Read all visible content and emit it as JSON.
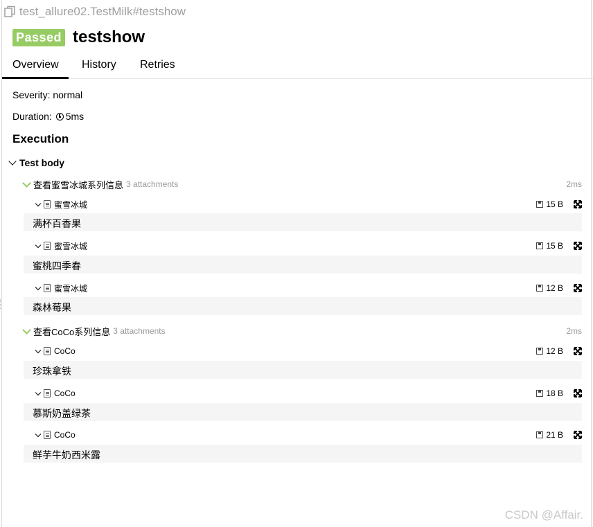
{
  "breadcrumb": "test_allure02.TestMilk#testshow",
  "status_badge": "Passed",
  "title": "testshow",
  "tabs": [
    {
      "label": "Overview",
      "active": true
    },
    {
      "label": "History",
      "active": false
    },
    {
      "label": "Retries",
      "active": false
    }
  ],
  "severity": "Severity: normal",
  "duration_label": "Duration:",
  "duration_value": "5ms",
  "execution_heading": "Execution",
  "test_body_label": "Test body",
  "steps": [
    {
      "name": "查看蜜雪冰城系列信息",
      "attachments_label": "3 attachments",
      "duration": "2ms",
      "attachments": [
        {
          "name": "蜜雪冰城",
          "size": "15 B",
          "content": "满杯百香果"
        },
        {
          "name": "蜜雪冰城",
          "size": "15 B",
          "content": "蜜桃四季春"
        },
        {
          "name": "蜜雪冰城",
          "size": "12 B",
          "content": "森林莓果"
        }
      ]
    },
    {
      "name": "查看CoCo系列信息",
      "attachments_label": "3 attachments",
      "duration": "2ms",
      "attachments": [
        {
          "name": "CoCo",
          "size": "12 B",
          "content": "珍珠拿铁"
        },
        {
          "name": "CoCo",
          "size": "18 B",
          "content": "慕斯奶盖绿茶"
        },
        {
          "name": "CoCo",
          "size": "21 B",
          "content": "鲜芋牛奶西米露"
        }
      ]
    }
  ],
  "watermark": "CSDN @Affair.",
  "colors": {
    "passed": "#97cc64",
    "muted": "#999999",
    "content_bg": "#f5f5f5"
  }
}
